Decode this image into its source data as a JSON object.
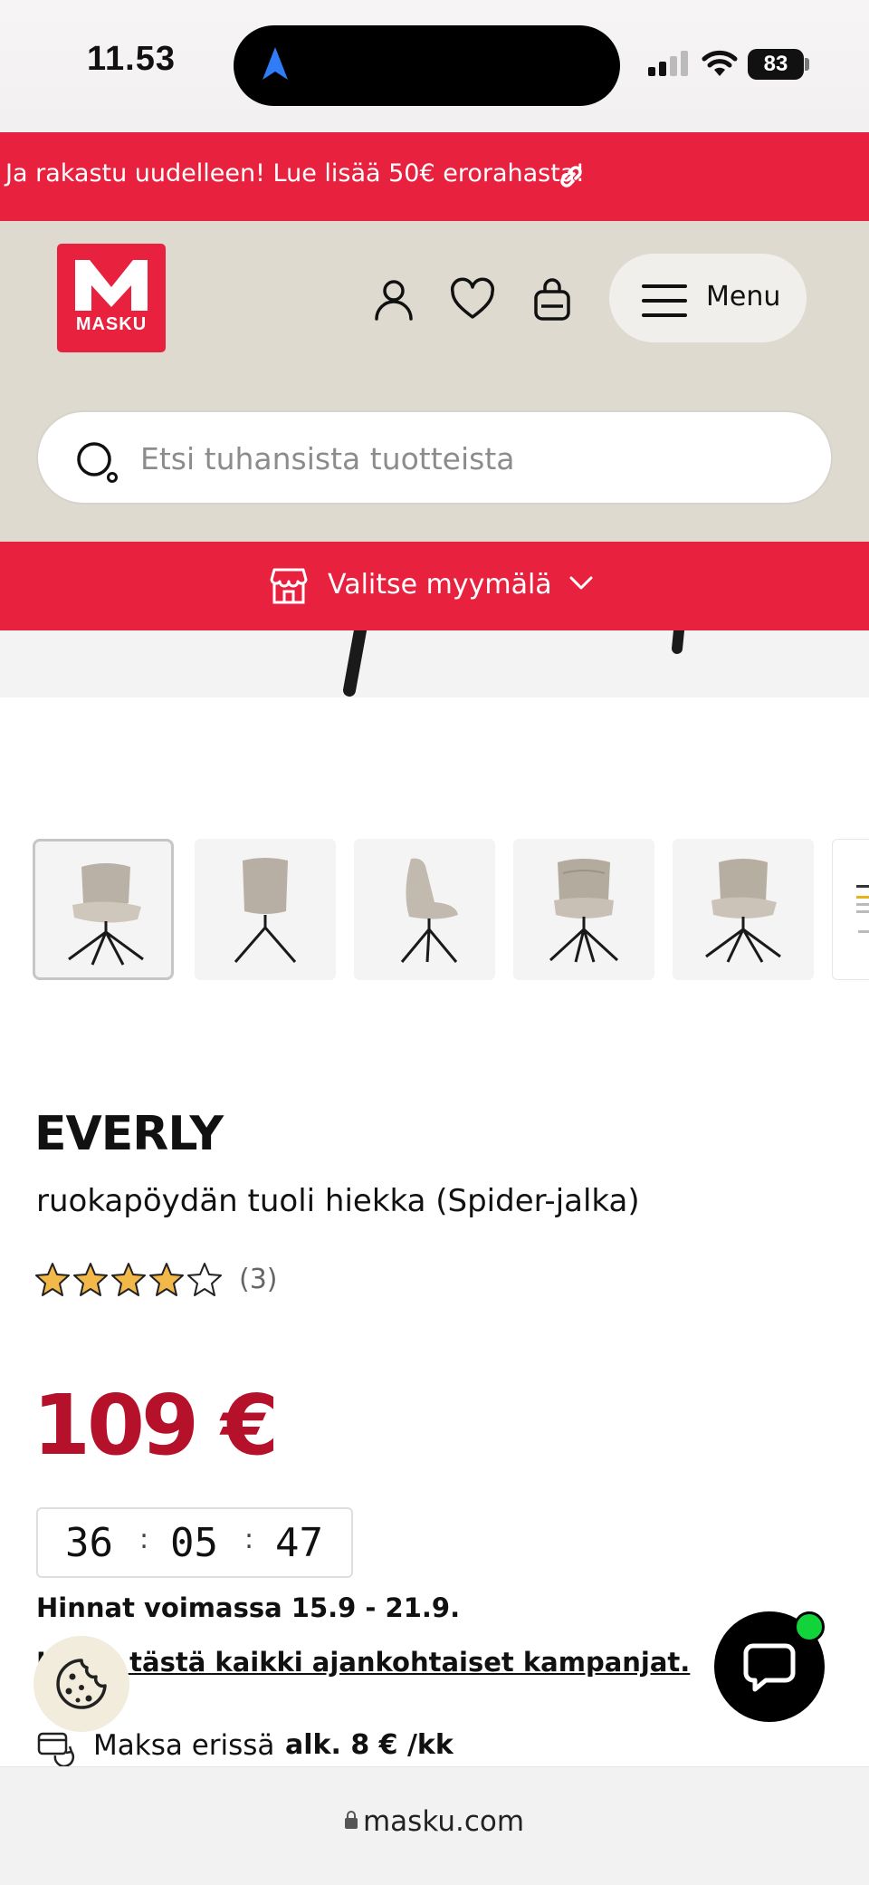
{
  "status_bar": {
    "time": "11.53",
    "battery": "83"
  },
  "promo_banner": {
    "text": "Ja rakastu uudelleen! Lue lisää 50€ erorahasta!"
  },
  "header": {
    "logo_text": "MASKU",
    "menu_label": "Menu",
    "search_placeholder": "Etsi tuhansista tuotteista"
  },
  "store_selector": {
    "label": "Valitse myymälä"
  },
  "thumbnails": {
    "count_visible": 6,
    "selected_index": 0
  },
  "product": {
    "brand": "EVERLY",
    "name": "ruokapöydän tuoli hiekka (Spider-jalka)",
    "rating": 4,
    "rating_max": 5,
    "review_count": "(3)",
    "price": "109 €"
  },
  "countdown": {
    "hours": "36",
    "minutes": "05",
    "seconds": "47",
    "separator": ":"
  },
  "offer": {
    "validity": "Hinnat voimassa 15.9 - 21.9.",
    "campaign_link": "Katso tästä kaikki ajankohtaiset kampanjat."
  },
  "installment": {
    "label": "Maksa erissä",
    "amount": "alk. 8 € /kk"
  },
  "browser": {
    "url": "masku.com"
  },
  "colors": {
    "brand_red": "#e8213f",
    "price_red": "#b5112b",
    "header_beige": "#dedad0",
    "star": "#f3b84a"
  }
}
